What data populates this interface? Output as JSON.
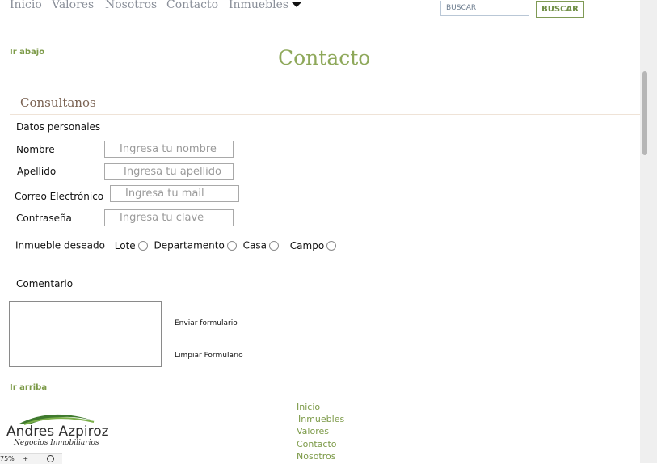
{
  "nav": {
    "items": [
      "Inicio",
      "Valores",
      "Nosotros",
      "Contacto",
      "Inmuebles"
    ]
  },
  "search": {
    "placeholder": "BUSCAR",
    "button_label": "BUSCAR"
  },
  "links": {
    "go_down": "Ir abajo",
    "go_up": "Ir arriba"
  },
  "page_title": "Contacto",
  "section_title": "Consultanos",
  "form": {
    "group_label": "Datos personales",
    "name_label": "Nombre",
    "name_placeholder": "Ingresa tu nombre",
    "surname_label": "Apellido",
    "surname_placeholder": "Ingresa tu apellido",
    "email_label": "Correo Electrónico",
    "email_placeholder": "Ingresa tu mail",
    "password_label": "Contraseña",
    "password_placeholder": "Ingresa tu clave",
    "property_label": "Inmueble deseado",
    "property_options": [
      "Lote",
      "Departamento",
      "Casa",
      "Campo"
    ],
    "comment_label": "Comentario",
    "submit_label": "Enviar formulario",
    "reset_label": "Limpiar Formulario"
  },
  "footer": {
    "nav": [
      "Inicio",
      "Inmuebles",
      "Valores",
      "Contacto",
      "Nosotros"
    ],
    "logo_name": "Andres Azpiroz",
    "logo_tagline": "Negocios Inmobiliarios"
  },
  "zoom": {
    "level": "75%",
    "plus": "+"
  },
  "colors": {
    "accent_green": "#8ea85a",
    "link_green": "#7c9a48",
    "section_brown": "#7a6252"
  }
}
